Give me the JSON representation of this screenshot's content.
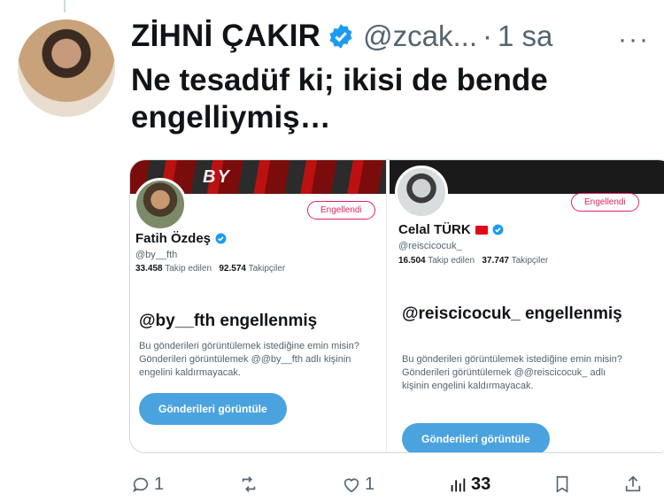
{
  "tweet": {
    "author_name": "ZİHNİ ÇAKIR",
    "handle": "@zcak...",
    "separator": "·",
    "time": "1 sa",
    "more": "···",
    "text": "Ne tesadüf ki; ikisi de bende engelliymiş…"
  },
  "media": {
    "left": {
      "banner_text": "BY",
      "blocked_label": "Engellendi",
      "name": "Fatih Özdeş",
      "handle": "@by__fth",
      "following_count": "33.458",
      "following_label": "Takip edilen",
      "followers_count": "92.574",
      "followers_label": "Takipçiler",
      "block_title": "@by__fth engellenmiş",
      "block_desc": "Bu gönderileri görüntülemek istediğine emin misin? Gönderileri görüntülemek @@by__fth adlı kişinin engelini kaldırmayacak.",
      "view_button": "Gönderileri görüntüle"
    },
    "right": {
      "blocked_label": "Engellendi",
      "name": "Celal TÜRK",
      "handle": "@reiscicocuk_",
      "following_count": "16.504",
      "following_label": "Takip edilen",
      "followers_count": "37.747",
      "followers_label": "Takipçiler",
      "block_title": "@reiscicocuk_ engellenmiş",
      "block_desc": "Bu gönderileri görüntülemek istediğine emin misin? Gönderileri görüntülemek @@reiscicocuk_ adlı kişinin engelini kaldırmayacak.",
      "view_button": "Gönderileri görüntüle"
    }
  },
  "actions": {
    "reply_count": "1",
    "retweet_count": "",
    "like_count": "1",
    "views_count": "33"
  },
  "icons": [
    "reply-icon",
    "retweet-icon",
    "like-icon",
    "views-icon",
    "bookmark-icon",
    "share-icon",
    "verified-icon",
    "more-icon"
  ],
  "colors": {
    "verified_blue": "#1d9bf0",
    "blocked_red": "#e0245e",
    "button_blue": "#4aa3df",
    "muted": "#536471"
  }
}
